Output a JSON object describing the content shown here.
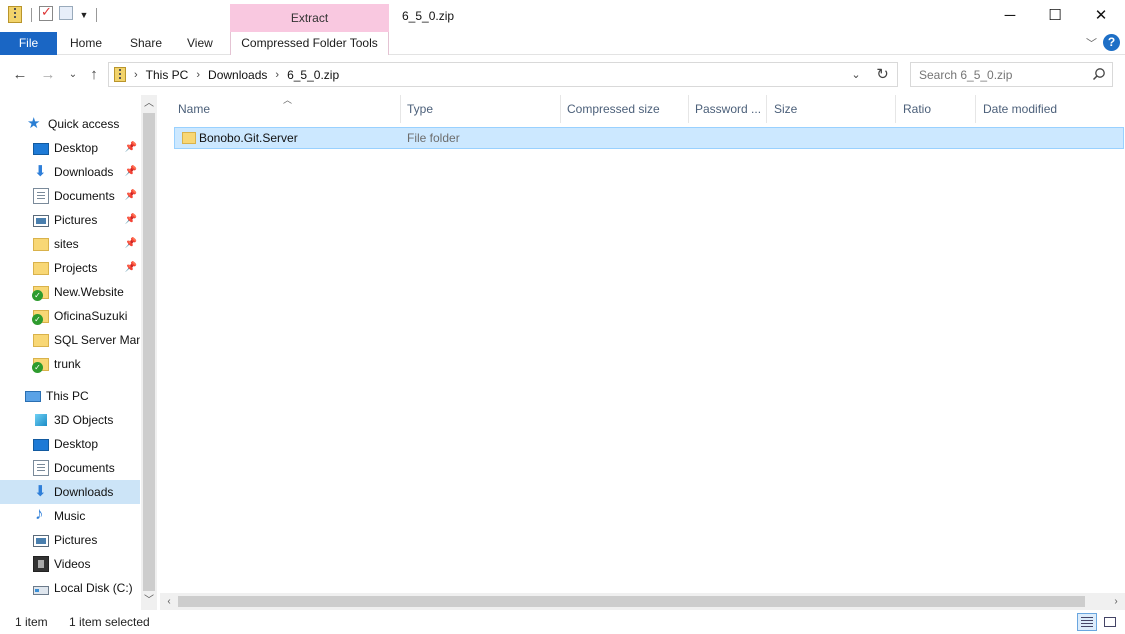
{
  "window": {
    "title": "6_5_0.zip",
    "context_tab_title": "Extract",
    "minimize_glyph": "─",
    "maximize_glyph": "☐",
    "close_glyph": "✕"
  },
  "ribbon": {
    "tabs": [
      "File",
      "Home",
      "Share",
      "View"
    ],
    "context_tab": "Compressed Folder Tools",
    "help": "?"
  },
  "address": {
    "crumbs": [
      "This PC",
      "Downloads",
      "6_5_0.zip"
    ],
    "search_placeholder": "Search 6_5_0.zip"
  },
  "sidebar": {
    "quick_access": {
      "label": "Quick access",
      "items": [
        {
          "label": "Desktop",
          "icon": "desktop-icon",
          "pinned": true
        },
        {
          "label": "Downloads",
          "icon": "download-icon",
          "pinned": true
        },
        {
          "label": "Documents",
          "icon": "documents-icon",
          "pinned": true
        },
        {
          "label": "Pictures",
          "icon": "pictures-icon",
          "pinned": true
        },
        {
          "label": "sites",
          "icon": "folder-icon",
          "pinned": true
        },
        {
          "label": "Projects",
          "icon": "folder-icon",
          "pinned": true
        },
        {
          "label": "New.Website",
          "icon": "synced-folder-icon",
          "pinned": false
        },
        {
          "label": "OficinaSuzuki",
          "icon": "synced-folder-icon",
          "pinned": false
        },
        {
          "label": "SQL Server Mana",
          "icon": "folder-icon",
          "pinned": false
        },
        {
          "label": "trunk",
          "icon": "synced-folder-icon",
          "pinned": false
        }
      ]
    },
    "this_pc": {
      "label": "This PC",
      "items": [
        {
          "label": "3D Objects",
          "icon": "3d-objects-icon"
        },
        {
          "label": "Desktop",
          "icon": "desktop-icon"
        },
        {
          "label": "Documents",
          "icon": "documents-icon"
        },
        {
          "label": "Downloads",
          "icon": "download-icon",
          "selected": true
        },
        {
          "label": "Music",
          "icon": "music-icon"
        },
        {
          "label": "Pictures",
          "icon": "pictures-icon"
        },
        {
          "label": "Videos",
          "icon": "videos-icon"
        },
        {
          "label": "Local Disk (C:)",
          "icon": "local-disk-icon"
        }
      ]
    }
  },
  "columns": [
    "Name",
    "Type",
    "Compressed size",
    "Password ...",
    "Size",
    "Ratio",
    "Date modified"
  ],
  "files": [
    {
      "name": "Bonobo.Git.Server",
      "type": "File folder",
      "selected": true
    }
  ],
  "status": {
    "item_count": "1 item",
    "selection": "1 item selected"
  },
  "colors": {
    "file_tab": "#1a66c4",
    "extract_context": "#f9c8e0",
    "selection": "#cce8ff"
  }
}
